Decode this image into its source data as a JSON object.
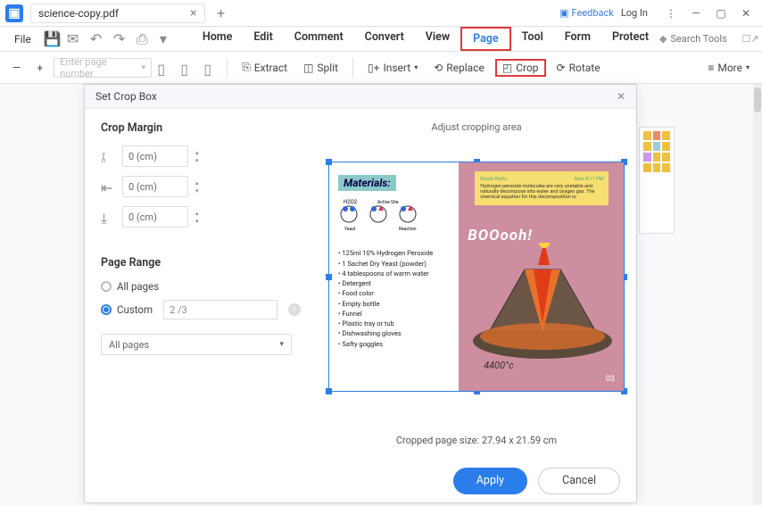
{
  "title": {
    "doc_name": "science-copy.pdf"
  },
  "header": {
    "feedback": "Feedback",
    "login": "Log In"
  },
  "menu": {
    "file": "File"
  },
  "tabs": {
    "home": "Home",
    "edit": "Edit",
    "comment": "Comment",
    "convert": "Convert",
    "view": "View",
    "page": "Page",
    "tool": "Tool",
    "form": "Form",
    "protect": "Protect"
  },
  "search": {
    "diamond": "◆",
    "placeholder": "Search Tools"
  },
  "toolbar": {
    "page_placeholder": "Enter page number",
    "extract": "Extract",
    "split": "Split",
    "insert": "Insert",
    "replace": "Replace",
    "crop": "Crop",
    "rotate": "Rotate",
    "more": "More"
  },
  "dialog": {
    "title": "Set Crop Box",
    "crop_margin": "Crop Margin",
    "top": "0 (cm)",
    "left": "0 (cm)",
    "bottom": "0 (cm)",
    "page_range": "Page Range",
    "all_pages": "All pages",
    "custom": "Custom",
    "custom_val": "2 /3",
    "pages_dd": "All pages",
    "adjust": "Adjust cropping area",
    "size": "Cropped page size: 27.94 x 21.59 cm",
    "apply": "Apply",
    "cancel": "Cancel"
  },
  "preview": {
    "materials_title": "Materials:",
    "diagram_labels": {
      "h2o2": "H2O2",
      "active": "Active Site",
      "yeast": "Yeast",
      "reaction": "Reaction"
    },
    "items": [
      "125ml 10% Hydrogen Peroxide",
      "1 Sachet Dry Yeast (powder)",
      "4 tablespoons of warm water",
      "Detergent",
      "Food color",
      "Empty bottle",
      "Funnel",
      "Plastic tray or tub",
      "Dishwashing gloves",
      "Safty goggles"
    ],
    "note_author": "Brook Watts",
    "note_time": "Mon 4:11 PM",
    "note_text": "Hydrogen peroxide molecules are very unstable and naturally decompose into water and oxygen gas. The chemical equation for this decomposition is:",
    "boom": "BOOooh!",
    "temp": "4400°c",
    "page_number": "03"
  }
}
